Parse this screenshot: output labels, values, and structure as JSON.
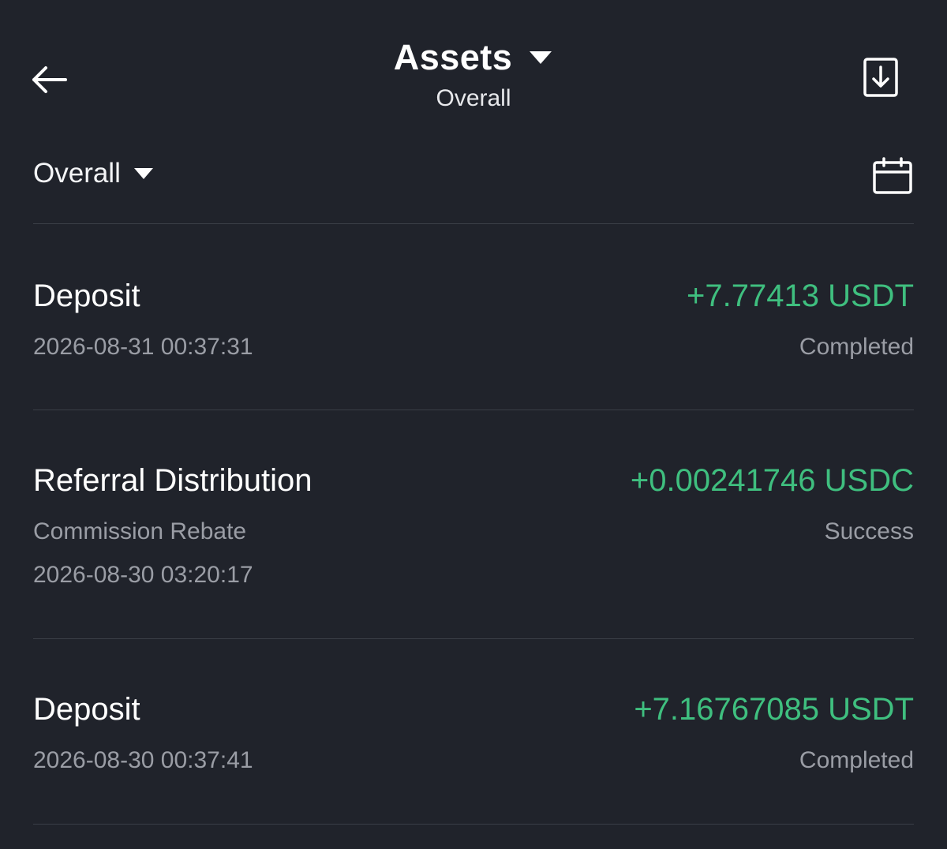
{
  "header": {
    "title": "Assets",
    "subtitle": "Overall"
  },
  "filter": {
    "selected": "Overall"
  },
  "transactions": [
    {
      "type": "Deposit",
      "amount": "+7.77413 USDT",
      "datetime": "2026-08-31 00:37:31",
      "status": "Completed"
    },
    {
      "type": "Referral Distribution",
      "subtype": "Commission Rebate",
      "amount": "+0.00241746 USDC",
      "datetime": "2026-08-30 03:20:17",
      "status": "Success"
    },
    {
      "type": "Deposit",
      "amount": "+7.16767085 USDT",
      "datetime": "2026-08-30 00:37:41",
      "status": "Completed"
    }
  ],
  "colors": {
    "background": "#20232b",
    "positive": "#3fbf7f",
    "muted": "#9a9da5",
    "divider": "#3a3e47"
  },
  "icons": {
    "back": "arrow-left-icon",
    "title_dropdown": "caret-down-icon",
    "download": "download-icon",
    "filter_dropdown": "caret-down-icon",
    "calendar": "calendar-icon"
  }
}
